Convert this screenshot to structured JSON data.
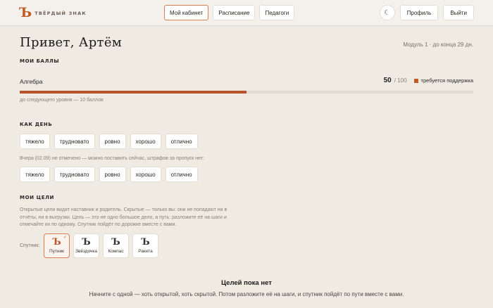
{
  "brand": {
    "mark": "Ъ",
    "name": "ТВЁРДЫЙ ЗНАК"
  },
  "nav": {
    "tabs": [
      {
        "label": "Мой кабинет",
        "active": true
      },
      {
        "label": "Расписание",
        "active": false
      },
      {
        "label": "Педагоги",
        "active": false
      }
    ]
  },
  "header_actions": {
    "theme_icon": "moon-icon",
    "theme_glyph": "☾",
    "profile_label": "Профиль",
    "logout_label": "Выйти"
  },
  "greeting": "Привет, Артём",
  "module_info": "Модуль 1 · до конца 29 дн.",
  "scores": {
    "title": "МОИ БАЛЛЫ",
    "subject": "Алгебра",
    "value": "50",
    "max": "/ 100",
    "progress": 0.5,
    "status": "требуется поддержка",
    "status_color": "#c05a26",
    "caption": "до следующего уровня — 10 баллов"
  },
  "day": {
    "title": "КАК ДЕНЬ",
    "options": [
      "тяжело",
      "трудновато",
      "ровно",
      "хорошо",
      "отлично"
    ],
    "missed_note": "Вчера (02.09) не отмечено — можно поставить сейчас, штрафов за пропуск нет:",
    "missed_options": [
      "тяжело",
      "трудновато",
      "ровно",
      "хорошо",
      "отлично"
    ]
  },
  "goals": {
    "title": "МОИ ЦЕЛИ",
    "description": "Открытые цели видят наставник и родитель. Скрытые — только вы: они не попадают ни в отчёты, ни в выгрузки. Цель — это не одно большое дело, а путь: разложите её на шаги и отмечайте их по одному. Спутник пойдёт по дорожке вместе с вами.",
    "companion_label": "Спутник:",
    "companions": [
      {
        "name": "Путник",
        "selected": true,
        "check": "✓"
      },
      {
        "name": "Звёздочка",
        "selected": false,
        "check": ""
      },
      {
        "name": "Компас",
        "selected": false,
        "check": ""
      },
      {
        "name": "Ракета",
        "selected": false,
        "check": ""
      }
    ],
    "companion_glyph": "Ъ",
    "empty_title": "Целей пока нет",
    "empty_text": "Начните с одной — хоть открытой, хоть скрытой. Потом разложите её на шаги, и спутник пойдёт по пути вместе с вами."
  },
  "colors": {
    "accent": "#c05a26",
    "bar": "#b9532a",
    "background": "#efebe3"
  }
}
